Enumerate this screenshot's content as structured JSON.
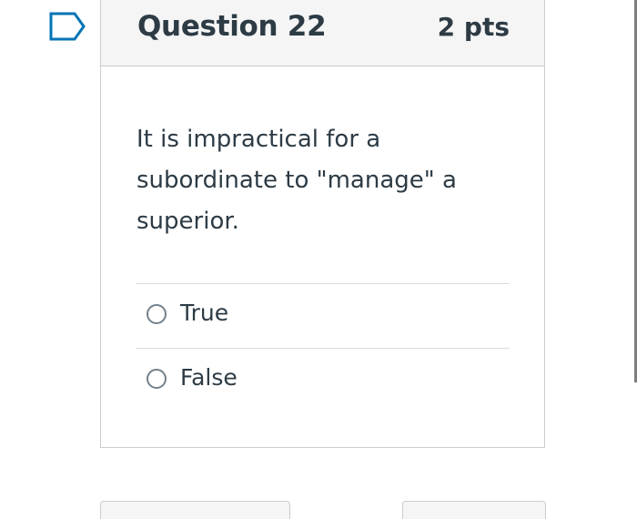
{
  "question": {
    "title": "Question 22",
    "points": "2 pts",
    "text": "It is impractical for a subordinate to \"manage\" a superior.",
    "flag_icon": "bookmark-flag-icon"
  },
  "answers": [
    {
      "label": "True",
      "selected": false
    },
    {
      "label": "False",
      "selected": false
    }
  ],
  "colors": {
    "text": "#2d3b45",
    "accent_flag": "#0374b5",
    "border": "#c7cdd1",
    "header_bg": "#f5f5f5"
  }
}
